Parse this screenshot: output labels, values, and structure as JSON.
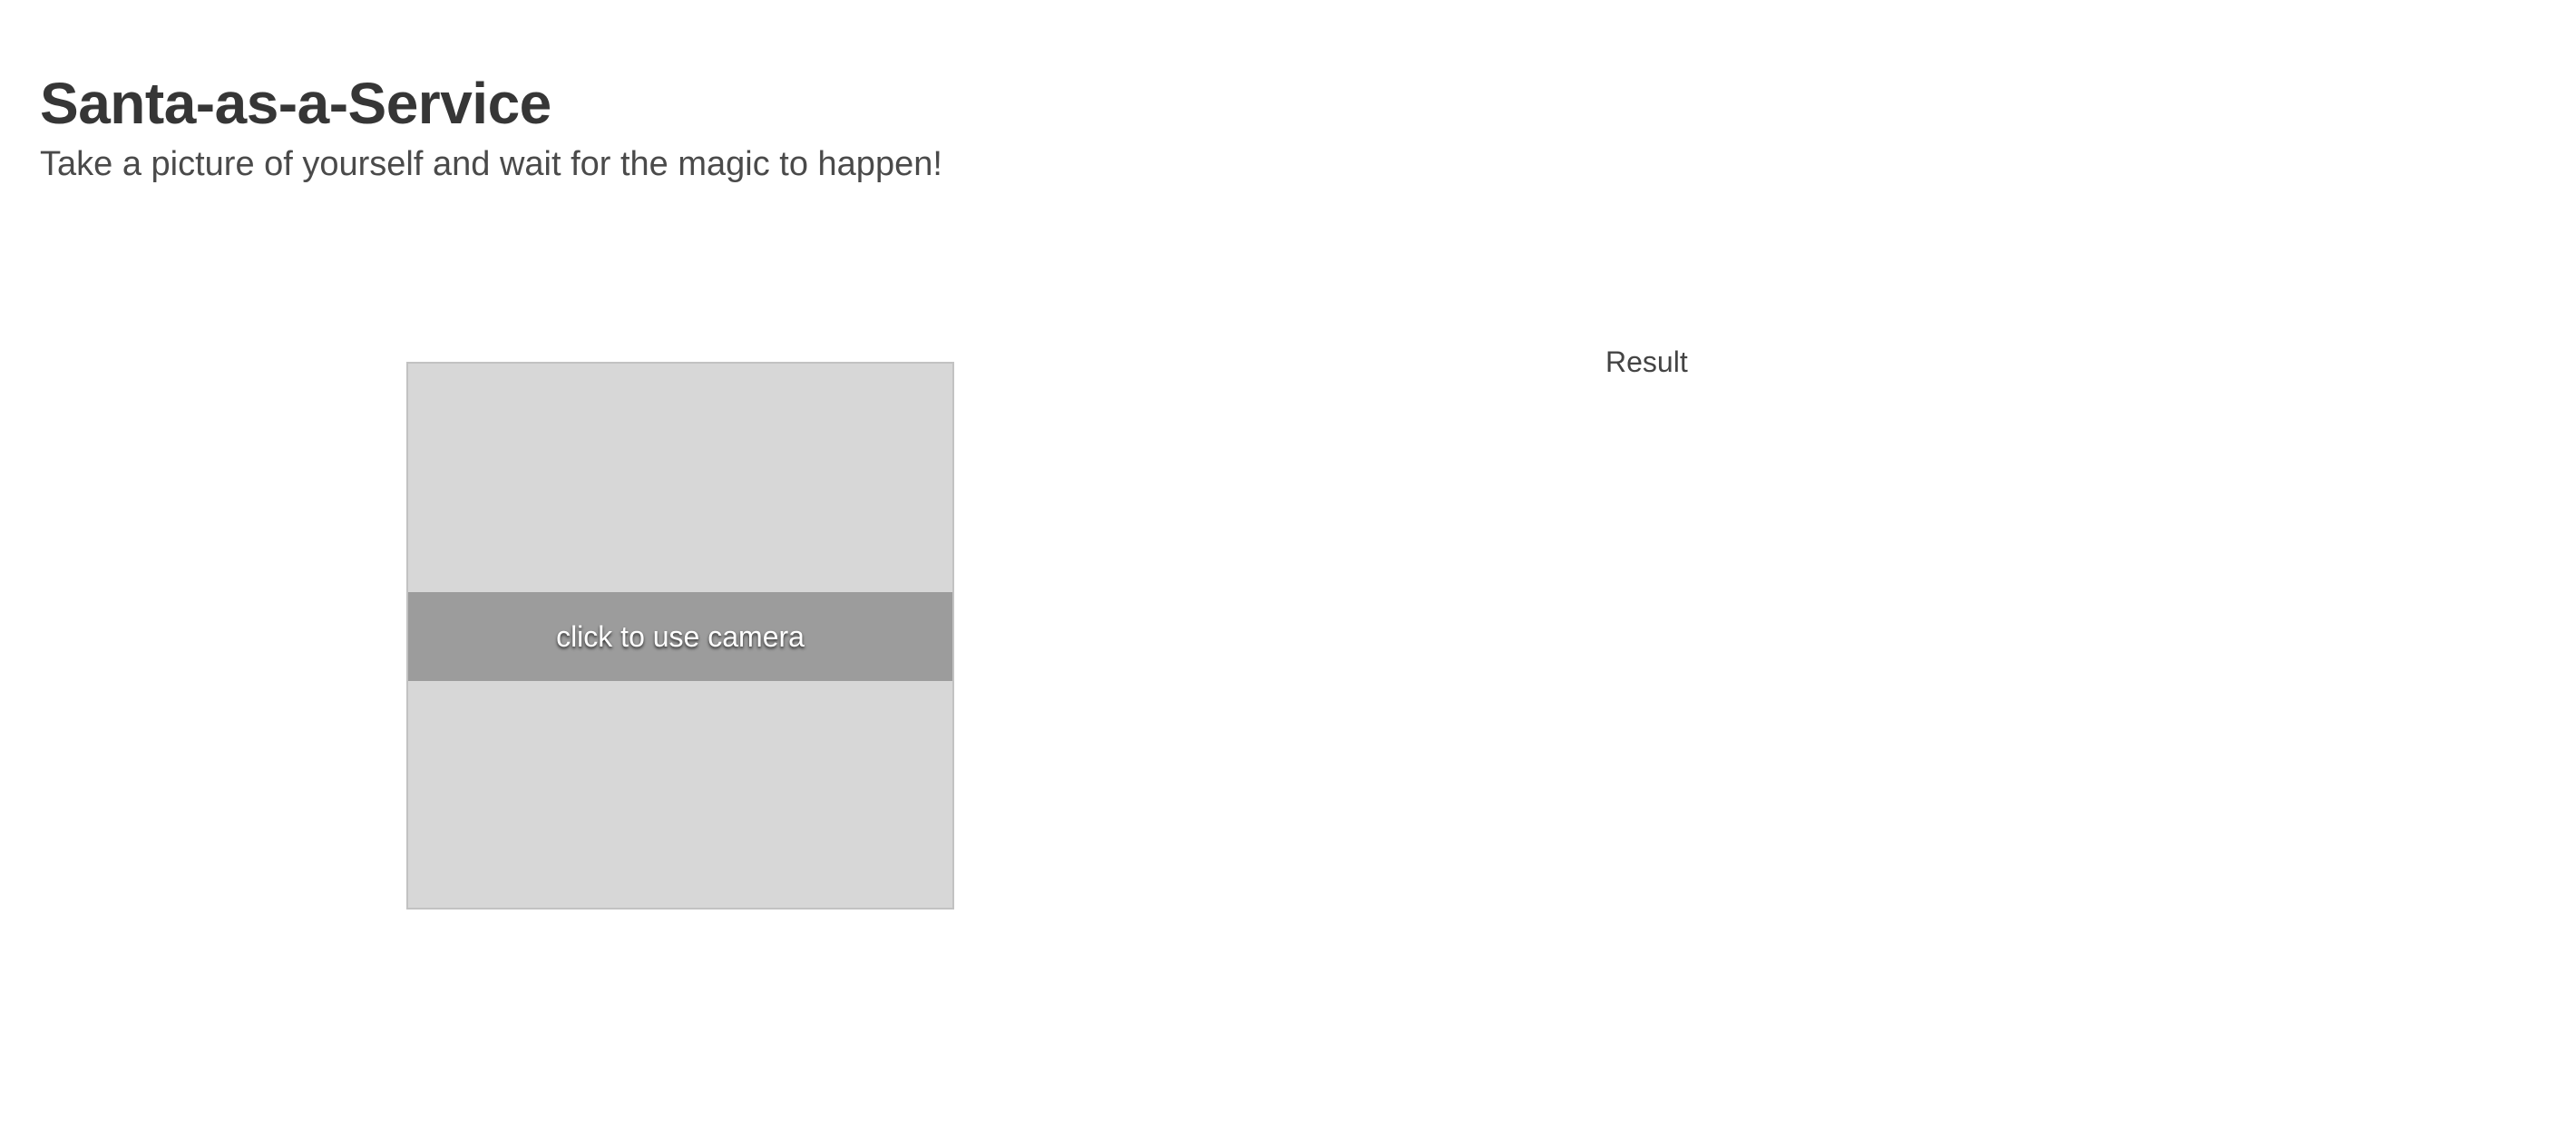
{
  "header": {
    "title": "Santa-as-a-Service",
    "subtitle": "Take a picture of yourself and wait for the magic to happen!"
  },
  "camera": {
    "label": "click to use camera"
  },
  "result": {
    "label": "Result"
  }
}
